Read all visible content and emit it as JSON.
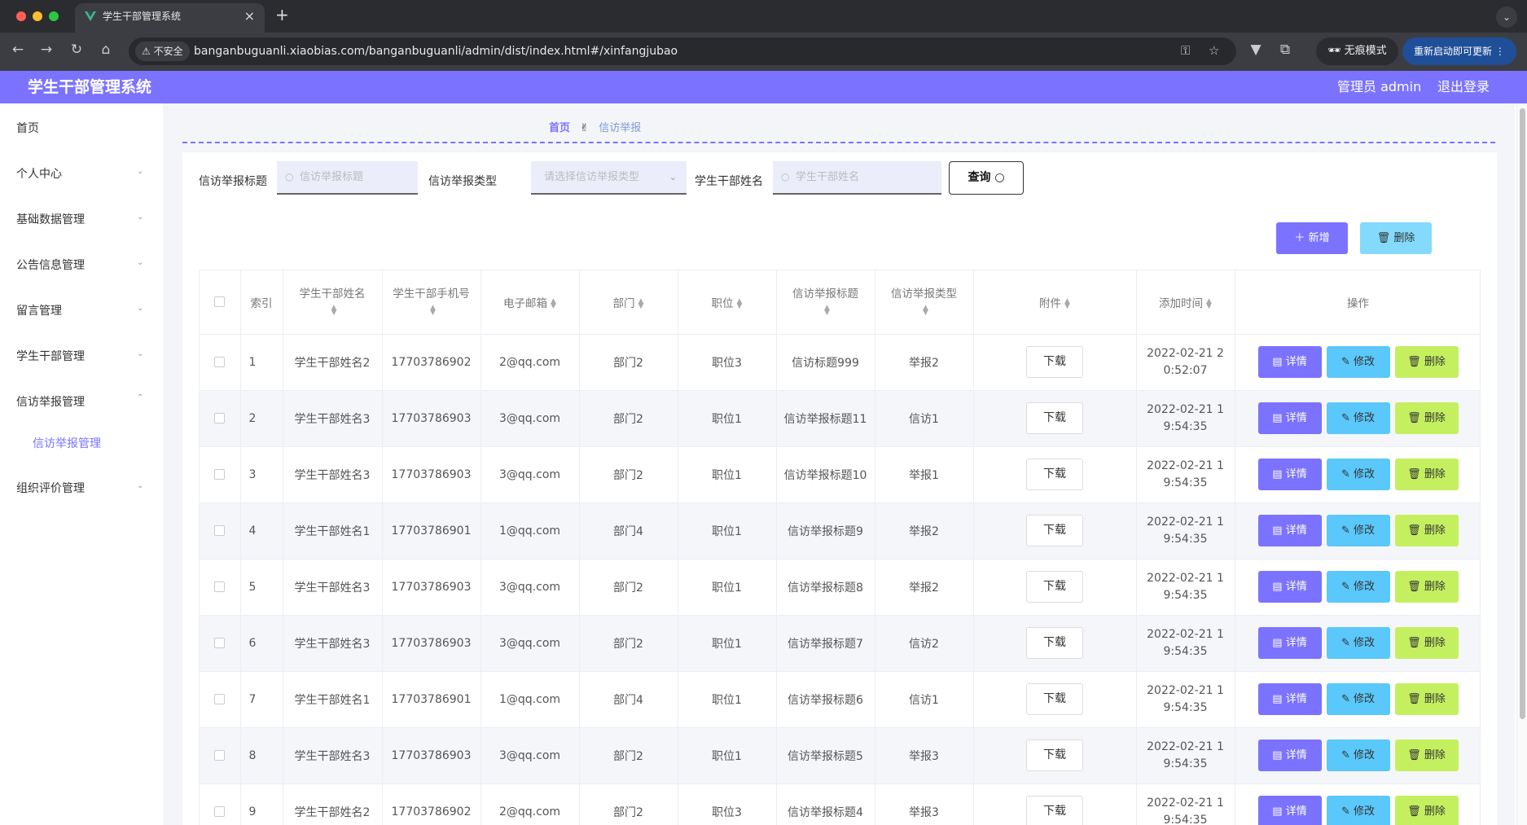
{
  "browser": {
    "tab_title": "学生干部管理系统",
    "new_tab": "+",
    "insecure_label": "不安全",
    "url": "banganbuguanli.xiaobias.com/banganbuguanli/admin/dist/index.html#/xinfangjubao",
    "incognito_label": "无痕模式",
    "relaunch_label": "重新启动即可更新"
  },
  "header": {
    "title": "学生干部管理系统",
    "user_label": "管理员 admin",
    "logout_label": "退出登录"
  },
  "sidebar": {
    "items": [
      {
        "label": "首页"
      },
      {
        "label": "个人中心"
      },
      {
        "label": "基础数据管理"
      },
      {
        "label": "公告信息管理"
      },
      {
        "label": "留言管理"
      },
      {
        "label": "学生干部管理"
      },
      {
        "label": "信访举报管理"
      },
      {
        "label": "组织评价管理"
      }
    ],
    "sub_item": "信访举报管理"
  },
  "breadcrumb": {
    "home": "首页",
    "separator": "✌",
    "current": "信访举报"
  },
  "filters": {
    "title_label": "信访举报标题",
    "title_placeholder": "信访举报标题",
    "type_label": "信访举报类型",
    "type_placeholder": "请选择信访举报类型",
    "name_label": "学生干部姓名",
    "name_placeholder": "学生干部姓名",
    "query_label": "查询"
  },
  "actions": {
    "add_label": "新增",
    "delete_label": "删除"
  },
  "table": {
    "columns": [
      "索引",
      "学生干部姓名",
      "学生干部手机号",
      "电子邮箱",
      "部门",
      "职位",
      "信访举报标题",
      "信访举报类型",
      "附件",
      "添加时间",
      "操作"
    ],
    "download_label": "下载",
    "detail_label": "详情",
    "edit_label": "修改",
    "delete_label": "删除",
    "rows": [
      {
        "index": "1",
        "name": "学生干部姓名2",
        "phone": "17703786902",
        "email": "2@qq.com",
        "dept": "部门2",
        "position": "职位3",
        "title": "信访标题999",
        "type": "举报2",
        "time": "2022-02-21 20:52:07"
      },
      {
        "index": "2",
        "name": "学生干部姓名3",
        "phone": "17703786903",
        "email": "3@qq.com",
        "dept": "部门2",
        "position": "职位1",
        "title": "信访举报标题11",
        "type": "信访1",
        "time": "2022-02-21 19:54:35"
      },
      {
        "index": "3",
        "name": "学生干部姓名3",
        "phone": "17703786903",
        "email": "3@qq.com",
        "dept": "部门2",
        "position": "职位1",
        "title": "信访举报标题10",
        "type": "举报1",
        "time": "2022-02-21 19:54:35"
      },
      {
        "index": "4",
        "name": "学生干部姓名1",
        "phone": "17703786901",
        "email": "1@qq.com",
        "dept": "部门4",
        "position": "职位1",
        "title": "信访举报标题9",
        "type": "举报2",
        "time": "2022-02-21 19:54:35"
      },
      {
        "index": "5",
        "name": "学生干部姓名3",
        "phone": "17703786903",
        "email": "3@qq.com",
        "dept": "部门2",
        "position": "职位1",
        "title": "信访举报标题8",
        "type": "举报2",
        "time": "2022-02-21 19:54:35"
      },
      {
        "index": "6",
        "name": "学生干部姓名3",
        "phone": "17703786903",
        "email": "3@qq.com",
        "dept": "部门2",
        "position": "职位1",
        "title": "信访举报标题7",
        "type": "信访2",
        "time": "2022-02-21 19:54:35"
      },
      {
        "index": "7",
        "name": "学生干部姓名1",
        "phone": "17703786901",
        "email": "1@qq.com",
        "dept": "部门4",
        "position": "职位1",
        "title": "信访举报标题6",
        "type": "信访1",
        "time": "2022-02-21 19:54:35"
      },
      {
        "index": "8",
        "name": "学生干部姓名3",
        "phone": "17703786903",
        "email": "3@qq.com",
        "dept": "部门2",
        "position": "职位1",
        "title": "信访举报标题5",
        "type": "举报3",
        "time": "2022-02-21 19:54:35"
      },
      {
        "index": "9",
        "name": "学生干部姓名2",
        "phone": "17703786902",
        "email": "2@qq.com",
        "dept": "部门2",
        "position": "职位3",
        "title": "信访举报标题4",
        "type": "举报3",
        "time": "2022-02-21 19:54:35"
      }
    ]
  },
  "colors": {
    "accent": "#7b73ff",
    "info": "#5ac8fa",
    "warn": "#c4f060",
    "cyan": "#83dafc"
  }
}
